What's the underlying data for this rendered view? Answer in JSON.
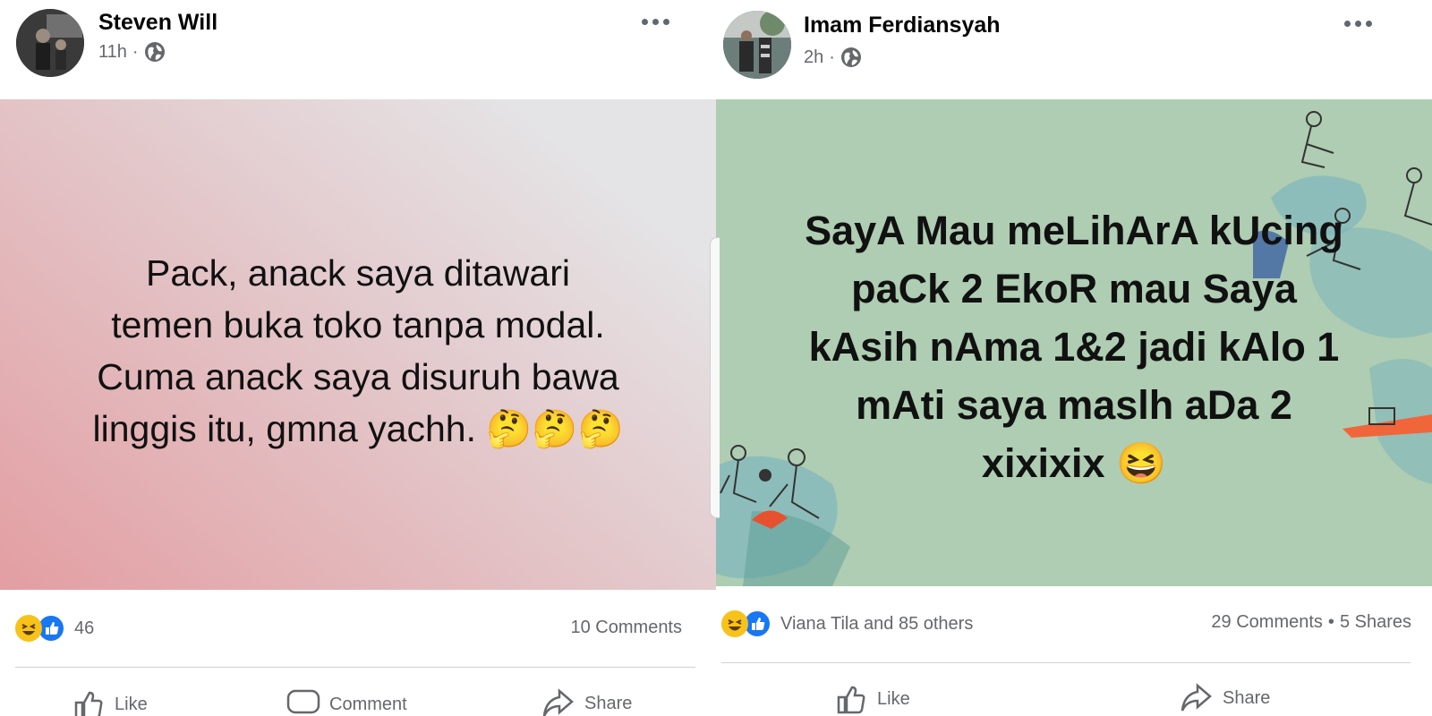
{
  "post_left": {
    "author": "Steven Will",
    "time": "11h",
    "visibility_icon": "globe-icon",
    "text_lines": [
      "Pack, anack saya ditawari",
      "temen buka toko tanpa modal.",
      "Cuma anack saya disuruh bawa",
      "linggis itu, gmna yachh. 🤔🤔🤔"
    ],
    "background": [
      "#e39ea2",
      "#e4e4e6"
    ],
    "reactions": [
      "haha-icon",
      "like-icon"
    ],
    "reaction_count": "46",
    "comments": "10 Comments",
    "actions": {
      "like": "Like",
      "comment": "Comment",
      "share": "Share"
    }
  },
  "post_right": {
    "author": "Imam Ferdiansyah",
    "time": "2h",
    "visibility_icon": "globe-icon",
    "text_lines": [
      "SayA Mau meLihArA kUcing",
      "paCk 2 EkoR mau Saya",
      "kAsih nAma 1&2 jadi kAlo 1",
      "mAti saya maslh aDa 2",
      "xixixix 😆"
    ],
    "background": "#aecdb2",
    "reactions": [
      "haha-icon",
      "like-icon"
    ],
    "reaction_names": "Viana Tila and 85 others",
    "comments": "29 Comments",
    "shares": "5 Shares",
    "actions": {
      "like": "Like",
      "share": "Share"
    }
  }
}
